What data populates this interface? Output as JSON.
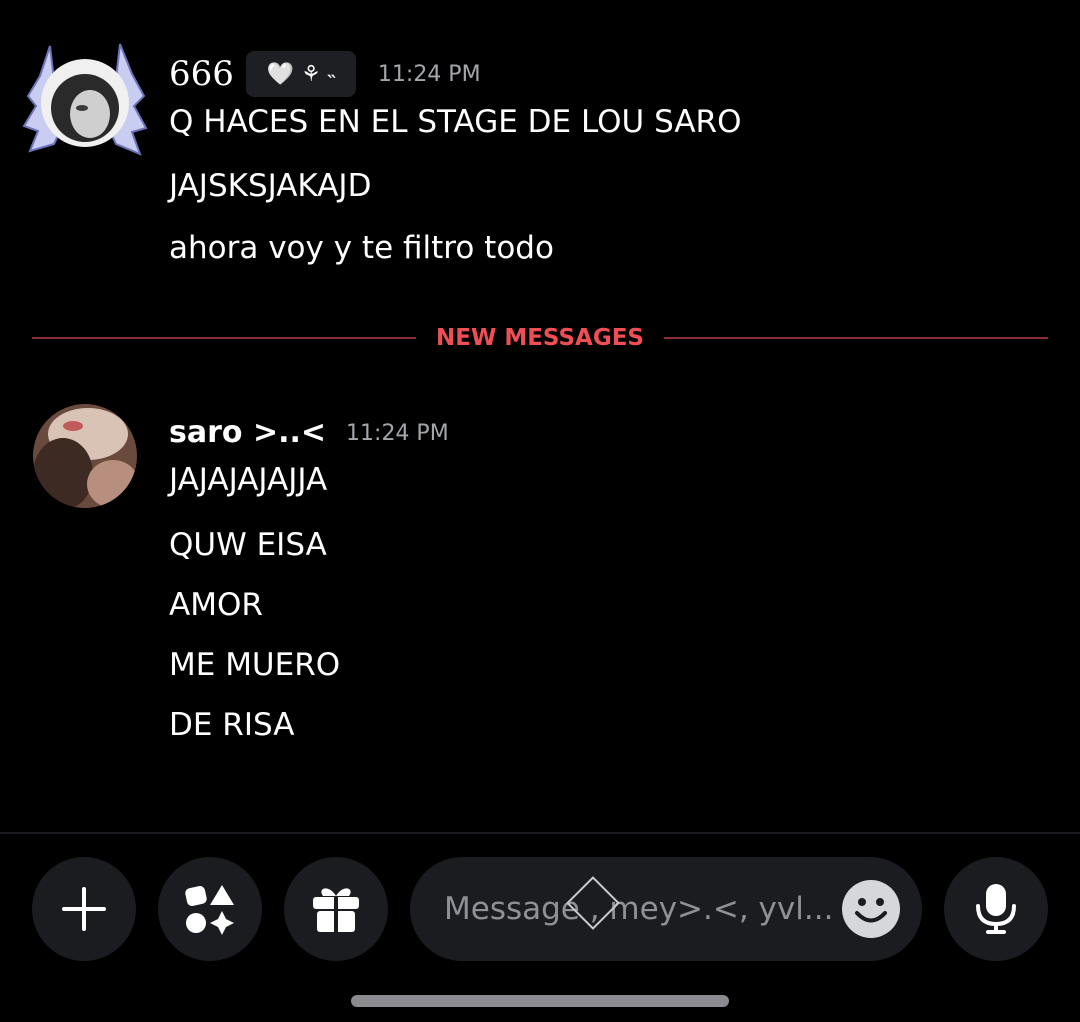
{
  "messages": [
    {
      "username": "666",
      "tag_text": "🤍 ⚘ ˵",
      "timestamp": "11:24 PM",
      "lines": [
        "Q HACES EN EL STAGE DE LOU SARO",
        "JAJSKSJAKAJD",
        "ahora voy y te filtro todo"
      ]
    },
    {
      "username": "saro >..<",
      "timestamp": "11:24 PM",
      "lines": [
        "JAJAJAJAJJA",
        "QUW EISA",
        "AMOR",
        "ME MUERO",
        "DE RISA"
      ]
    }
  ],
  "divider": {
    "label": "NEW MESSAGES",
    "color": "#f04e55"
  },
  "composer": {
    "placeholder": "Message , mey>.<, yvl..."
  },
  "icons": {
    "plus": "plus-icon",
    "apps": "apps-icon",
    "gift": "gift-icon",
    "emoji": "emoji-icon",
    "mic": "microphone-icon"
  },
  "colors": {
    "background": "#000000",
    "surface": "#1b1c20",
    "muted_text": "#a3a6aa",
    "accent_red": "#f04e55"
  }
}
